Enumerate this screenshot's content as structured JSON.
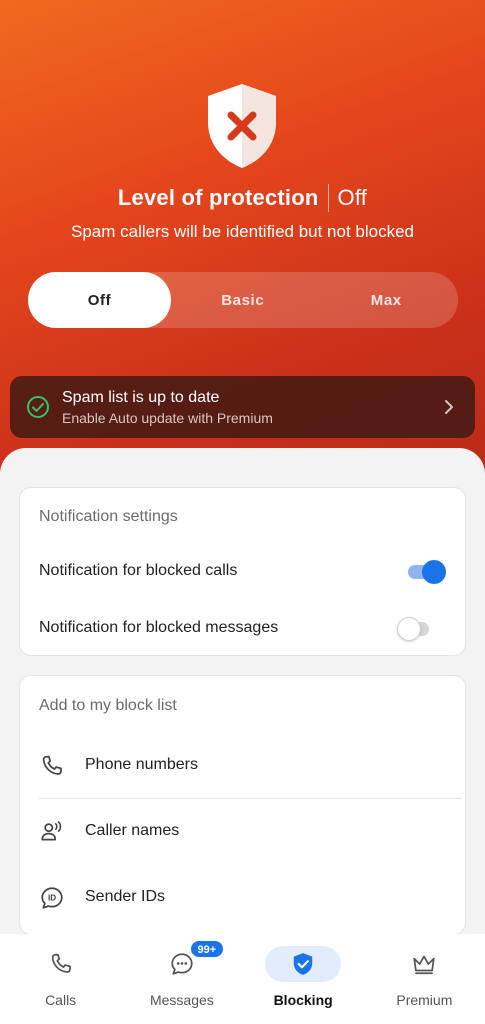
{
  "header": {
    "title": "Level of protection",
    "status": "Off",
    "subtitle": "Spam callers will be identified but not blocked"
  },
  "protection_levels": {
    "selected": "Off",
    "options": [
      "Off",
      "Basic",
      "Max"
    ]
  },
  "spam_banner": {
    "title": "Spam list is up to date",
    "subtitle": "Enable Auto update with Premium"
  },
  "notification_settings": {
    "title": "Notification settings",
    "blocked_calls_label": "Notification for blocked calls",
    "blocked_calls_enabled": true,
    "blocked_messages_label": "Notification for blocked messages",
    "blocked_messages_enabled": false
  },
  "block_list": {
    "title": "Add to my block list",
    "items": [
      {
        "label": "Phone numbers",
        "icon": "phone-icon"
      },
      {
        "label": "Caller names",
        "icon": "person-voice-icon"
      },
      {
        "label": "Sender IDs",
        "icon": "sender-id-icon"
      }
    ]
  },
  "bottom_nav": {
    "items": [
      {
        "label": "Calls",
        "icon": "phone-icon"
      },
      {
        "label": "Messages",
        "icon": "message-icon",
        "badge": "99+"
      },
      {
        "label": "Blocking",
        "icon": "shield-check-icon"
      },
      {
        "label": "Premium",
        "icon": "crown-icon"
      }
    ],
    "active": "Blocking"
  },
  "colors": {
    "accent": "#1a73e8",
    "hero_start": "#f06a1e",
    "hero_end": "#b52a18",
    "shield_cross": "#d63a1a",
    "check_green": "#34c26a"
  }
}
